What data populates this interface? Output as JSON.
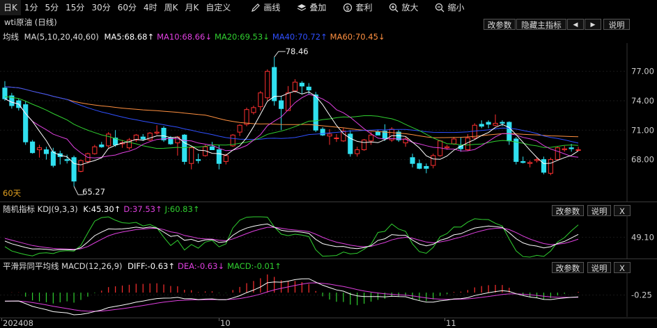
{
  "toolbar": {
    "periods": [
      "日K",
      "1分",
      "5分",
      "15分",
      "30分",
      "60分",
      "4时",
      "周K",
      "月K",
      "自定义"
    ],
    "active_period": "日K",
    "tools": [
      {
        "icon": "pencil-icon",
        "label": "画线"
      },
      {
        "icon": "layers-icon",
        "label": "叠加"
      },
      {
        "icon": "arbitrage-icon",
        "label": "套利"
      },
      {
        "icon": "zoom-in-icon",
        "label": "放大"
      },
      {
        "icon": "zoom-out-icon",
        "label": "缩小"
      }
    ]
  },
  "main_panel": {
    "title": "wti原油 (日线)",
    "buttons": {
      "change_params": "改参数",
      "hide_indicator": "隐藏主指标",
      "left": "◀",
      "right": "▶",
      "help": "说明"
    },
    "ma_label": "均线",
    "ma_params": "MA(5,10,20,40,60)",
    "ma_values": [
      {
        "text": "MA5:68.68↑",
        "color": "#ffffff"
      },
      {
        "text": "MA10:68.66↓",
        "color": "#e040e0"
      },
      {
        "text": "MA20:69.53↓",
        "color": "#30d030"
      },
      {
        "text": "MA40:70.72↑",
        "color": "#3050ff"
      },
      {
        "text": "MA60:70.45↓",
        "color": "#ff9040"
      }
    ],
    "y_ticks": [
      "77.00",
      "74.00",
      "71.00",
      "68.00"
    ],
    "high_label": "78.46",
    "low_label": "65.27",
    "corner_label": "60天"
  },
  "kdj_panel": {
    "title": "随机指标 KDJ(9,3,3)",
    "values": [
      {
        "text": "K:45.30↑",
        "color": "#ffffff"
      },
      {
        "text": "D:37.53↑",
        "color": "#e040e0"
      },
      {
        "text": "J:60.83↑",
        "color": "#30d030"
      }
    ],
    "buttons": {
      "change_params": "改参数",
      "help": "说明",
      "close": "X"
    },
    "y_tick": "49.10"
  },
  "macd_panel": {
    "title": "平滑异同平均线 MACD(12,26,9)",
    "values": [
      {
        "text": "DIFF:-0.63↑",
        "color": "#ffffff"
      },
      {
        "text": "DEA:-0.63↓",
        "color": "#e040e0"
      },
      {
        "text": "MACD:-0.01↑",
        "color": "#30d030"
      }
    ],
    "buttons": {
      "change_params": "改参数",
      "help": "说明",
      "close": "X"
    },
    "y_tick": "-0.25"
  },
  "x_axis": {
    "labels": [
      "202408",
      "10",
      "11"
    ]
  },
  "colors": {
    "up": "#ff3030",
    "down": "#30e0f0",
    "ma5": "#ffffff",
    "ma10": "#e040e0",
    "ma20": "#30d030",
    "ma40": "#3050ff",
    "ma60": "#ff9040"
  },
  "chart_data": {
    "type": "candlestick",
    "ohlc": [
      [
        75.3,
        76.0,
        74.0,
        74.2
      ],
      [
        74.5,
        74.8,
        73.2,
        73.5
      ],
      [
        74.0,
        74.2,
        73.0,
        73.3
      ],
      [
        73.6,
        74.0,
        69.5,
        69.8
      ],
      [
        69.8,
        70.0,
        68.6,
        68.7
      ],
      [
        69.0,
        69.5,
        68.2,
        69.2
      ],
      [
        69.0,
        69.3,
        68.0,
        68.6
      ],
      [
        68.8,
        69.2,
        67.2,
        67.4
      ],
      [
        68.6,
        68.9,
        67.5,
        68.3
      ],
      [
        68.0,
        68.5,
        67.6,
        67.9
      ],
      [
        68.2,
        68.4,
        65.27,
        65.8
      ],
      [
        66.8,
        68.0,
        66.7,
        67.9
      ],
      [
        67.8,
        68.7,
        67.6,
        68.6
      ],
      [
        68.6,
        69.5,
        68.5,
        69.3
      ],
      [
        69.5,
        69.8,
        69.2,
        69.3
      ],
      [
        69.4,
        70.8,
        69.2,
        70.6
      ],
      [
        70.2,
        71.0,
        69.3,
        69.5
      ],
      [
        69.6,
        70.0,
        69.2,
        69.7
      ],
      [
        69.2,
        70.2,
        69.0,
        70.0
      ],
      [
        70.0,
        70.6,
        69.8,
        70.5
      ],
      [
        70.3,
        70.6,
        69.9,
        70.1
      ],
      [
        70.0,
        70.8,
        69.9,
        70.7
      ],
      [
        70.7,
        71.5,
        70.5,
        70.8
      ],
      [
        71.2,
        71.4,
        69.8,
        70.0
      ],
      [
        70.2,
        70.4,
        69.5,
        69.6
      ],
      [
        69.7,
        70.4,
        68.4,
        70.3
      ],
      [
        70.5,
        70.6,
        67.5,
        67.8
      ],
      [
        67.6,
        69.3,
        67.0,
        69.2
      ],
      [
        68.0,
        68.6,
        67.6,
        67.9
      ],
      [
        68.4,
        69.5,
        68.3,
        69.3
      ],
      [
        69.3,
        69.8,
        69.0,
        69.0
      ],
      [
        69.0,
        69.5,
        67.0,
        67.6
      ],
      [
        67.8,
        68.6,
        67.5,
        68.4
      ],
      [
        69.4,
        70.6,
        69.3,
        70.5
      ],
      [
        70.8,
        71.6,
        70.4,
        71.5
      ],
      [
        71.6,
        73.3,
        71.4,
        73.1
      ],
      [
        72.8,
        73.5,
        72.6,
        73.3
      ],
      [
        73.4,
        75.0,
        73.0,
        74.8
      ],
      [
        74.3,
        77.2,
        74.0,
        77.0
      ],
      [
        77.4,
        78.46,
        73.5,
        74.0
      ],
      [
        74.0,
        74.5,
        71.0,
        73.2
      ],
      [
        73.0,
        75.5,
        73.0,
        74.8
      ],
      [
        75.0,
        76.2,
        74.8,
        75.9
      ],
      [
        75.8,
        76.0,
        74.7,
        75.5
      ],
      [
        75.4,
        75.8,
        74.6,
        75.1
      ],
      [
        74.6,
        74.9,
        70.8,
        71.0
      ],
      [
        71.1,
        71.3,
        70.4,
        70.5
      ],
      [
        70.4,
        71.1,
        69.5,
        70.6
      ],
      [
        70.2,
        70.6,
        69.8,
        70.2
      ],
      [
        69.9,
        71.2,
        69.8,
        70.9
      ],
      [
        70.6,
        71.0,
        68.3,
        68.6
      ],
      [
        68.6,
        69.3,
        68.3,
        69.0
      ],
      [
        69.0,
        70.1,
        68.9,
        70.0
      ],
      [
        69.9,
        70.8,
        69.5,
        70.5
      ],
      [
        70.8,
        71.0,
        70.5,
        70.5
      ],
      [
        70.9,
        71.6,
        69.9,
        70.1
      ],
      [
        70.0,
        71.3,
        69.8,
        71.1
      ],
      [
        70.8,
        71.0,
        69.8,
        70.0
      ],
      [
        69.7,
        70.3,
        69.3,
        70.1
      ],
      [
        68.2,
        68.6,
        67.2,
        67.6
      ],
      [
        67.6,
        68.0,
        67.0,
        67.1
      ],
      [
        67.3,
        67.6,
        66.6,
        67.1
      ],
      [
        67.4,
        68.6,
        67.1,
        68.4
      ],
      [
        68.4,
        70.0,
        68.3,
        69.9
      ],
      [
        69.2,
        69.5,
        69.0,
        69.3
      ],
      [
        69.6,
        70.3,
        69.5,
        70.1
      ],
      [
        69.4,
        70.3,
        68.8,
        69.1
      ],
      [
        69.0,
        70.6,
        68.9,
        70.2
      ],
      [
        70.2,
        71.7,
        70.1,
        71.5
      ],
      [
        71.6,
        72.0,
        71.2,
        71.4
      ],
      [
        71.8,
        72.0,
        71.2,
        71.6
      ],
      [
        71.5,
        72.6,
        71.4,
        71.7
      ],
      [
        71.8,
        72.0,
        71.4,
        71.7
      ],
      [
        71.8,
        71.9,
        69.5,
        69.9
      ],
      [
        70.1,
        70.3,
        67.5,
        67.8
      ],
      [
        67.8,
        68.3,
        67.6,
        67.7
      ],
      [
        67.6,
        67.9,
        67.2,
        67.7
      ],
      [
        67.9,
        68.2,
        67.7,
        68.0
      ],
      [
        68.0,
        68.3,
        66.5,
        66.7
      ],
      [
        66.6,
        68.2,
        66.4,
        68.0
      ],
      [
        68.0,
        69.3,
        67.9,
        69.2
      ],
      [
        69.0,
        69.4,
        68.8,
        69.1
      ],
      [
        69.2,
        69.6,
        68.8,
        69.1
      ],
      [
        69.0,
        69.3,
        68.9,
        69.0
      ]
    ],
    "x_labels": [
      "202408",
      "10",
      "11"
    ],
    "y_ticks": [
      77.0,
      74.0,
      71.0,
      68.0
    ],
    "high": 78.46,
    "low": 65.27
  }
}
